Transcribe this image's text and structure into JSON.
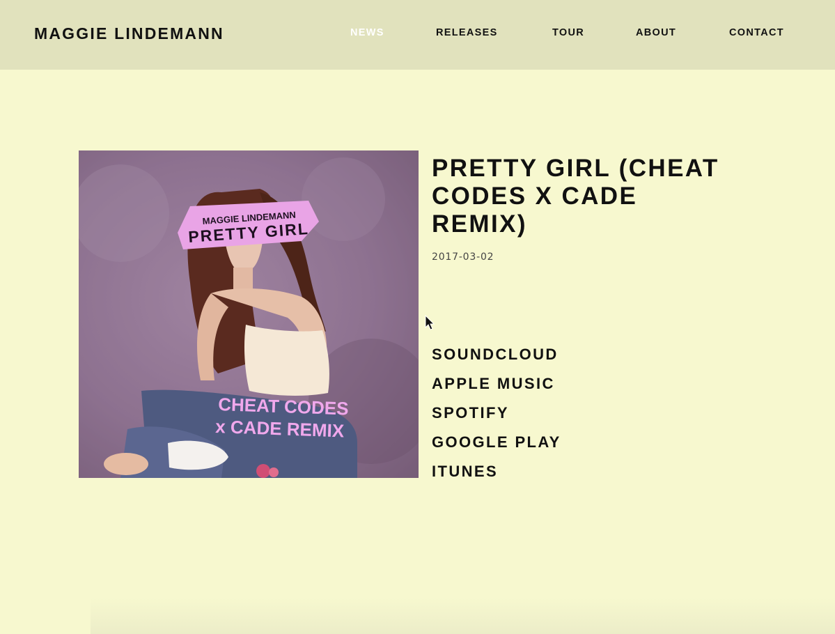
{
  "site": {
    "title": "MAGGIE LINDEMANN"
  },
  "nav": {
    "items": [
      {
        "label": "NEWS",
        "active": true
      },
      {
        "label": "RELEASES",
        "active": false
      },
      {
        "label": "TOUR",
        "active": false
      },
      {
        "label": "ABOUT",
        "active": false
      },
      {
        "label": "CONTACT",
        "active": false
      }
    ]
  },
  "release": {
    "title": "PRETTY GIRL (CHEAT CODES X CADE REMIX)",
    "date": "2017-03-02",
    "cover": {
      "artist_text": "MAGGIE LINDEMANN",
      "title_text": "PRETTY GIRL",
      "remix_line1": "CHEAT CODES",
      "remix_line2": "x CADE REMIX"
    },
    "links": [
      {
        "label": "SOUNDCLOUD"
      },
      {
        "label": "APPLE MUSIC"
      },
      {
        "label": "SPOTIFY"
      },
      {
        "label": "GOOGLE PLAY"
      },
      {
        "label": "ITUNES"
      }
    ]
  },
  "colors": {
    "page_bg": "#f7f8cf",
    "header_bg": "#e1e2bd",
    "active_nav": "#ffffff",
    "text": "#111111",
    "cover_pink": "#e9a4e6"
  }
}
